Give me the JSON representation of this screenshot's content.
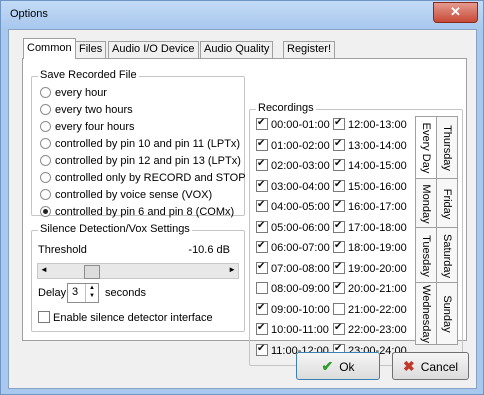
{
  "window": {
    "title": "Options",
    "close_glyph": "✕"
  },
  "tabs": [
    {
      "label": "Common",
      "active": true
    },
    {
      "label": "Files"
    },
    {
      "label": "Audio I/O Device"
    },
    {
      "label": "Audio Quality"
    },
    {
      "label": "Register!"
    }
  ],
  "save": {
    "legend": "Save Recorded File",
    "options": [
      "every hour",
      "every two hours",
      "every four hours",
      "controlled by pin 10 and pin 11 (LPTx)",
      "controlled by pin 12 and pin 13 (LPTx)",
      "controlled only by RECORD and STOP",
      "controlled by voice sense (VOX)",
      "controlled by pin 6 and pin 8 (COMx)"
    ],
    "selected_index": 7
  },
  "silence": {
    "legend": "Silence Detection/Vox Settings",
    "threshold_label": "Threshold",
    "threshold_value": "-10.6 dB",
    "slider_level": 0.2,
    "slider_left_arrow": "◄",
    "slider_right_arrow": "►",
    "delay_label": "Delay",
    "delay_value": "3",
    "delay_unit": "seconds",
    "enable_label": "Enable silence detector interface",
    "enable_checked": false
  },
  "recordings": {
    "legend": "Recordings",
    "left": [
      {
        "label": "00:00-01:00",
        "checked": true
      },
      {
        "label": "01:00-02:00",
        "checked": true
      },
      {
        "label": "02:00-03:00",
        "checked": true
      },
      {
        "label": "03:00-04:00",
        "checked": true
      },
      {
        "label": "04:00-05:00",
        "checked": true
      },
      {
        "label": "05:00-06:00",
        "checked": true
      },
      {
        "label": "06:00-07:00",
        "checked": true
      },
      {
        "label": "07:00-08:00",
        "checked": true
      },
      {
        "label": "08:00-09:00",
        "checked": false
      },
      {
        "label": "09:00-10:00",
        "checked": true
      },
      {
        "label": "10:00-11:00",
        "checked": true
      },
      {
        "label": "11:00-12:00",
        "checked": true
      }
    ],
    "right": [
      {
        "label": "12:00-13:00",
        "checked": true
      },
      {
        "label": "13:00-14:00",
        "checked": true
      },
      {
        "label": "14:00-15:00",
        "checked": true
      },
      {
        "label": "15:00-16:00",
        "checked": true
      },
      {
        "label": "16:00-17:00",
        "checked": true
      },
      {
        "label": "17:00-18:00",
        "checked": true
      },
      {
        "label": "18:00-19:00",
        "checked": true
      },
      {
        "label": "19:00-20:00",
        "checked": true
      },
      {
        "label": "20:00-21:00",
        "checked": true
      },
      {
        "label": "21:00-22:00",
        "checked": false
      },
      {
        "label": "22:00-23:00",
        "checked": true
      },
      {
        "label": "23:00-24:00",
        "checked": true
      }
    ],
    "days": [
      "Every Day",
      "Monday",
      "Tuesday",
      "Wednesday",
      "Thursday",
      "Friday",
      "Saturday",
      "Sunday"
    ],
    "active_day": "Every Day"
  },
  "buttons": {
    "ok_label": "Ok",
    "cancel_label": "Cancel",
    "ok_icon_color": "#2e9e2e",
    "cancel_icon_color": "#c0392b"
  }
}
